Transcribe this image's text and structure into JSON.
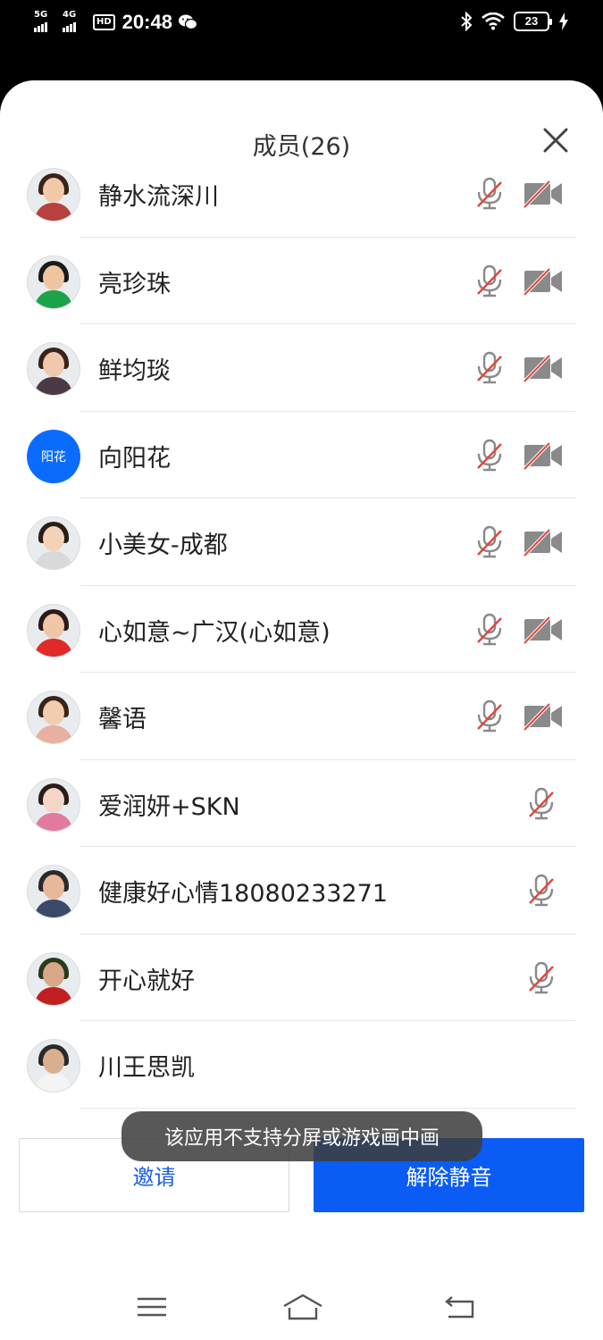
{
  "status_bar": {
    "signal1_label": "5G",
    "signal2_label": "4G",
    "hd_label": "HD",
    "time": "20:48",
    "battery": "23"
  },
  "sheet": {
    "title": "成员(26)"
  },
  "members": [
    {
      "name": "静水流深川",
      "avatar": "photo",
      "mic_muted": true,
      "camera_off": true
    },
    {
      "name": "亮珍珠",
      "avatar": "photo",
      "mic_muted": true,
      "camera_off": true
    },
    {
      "name": "鲜均琰",
      "avatar": "photo",
      "mic_muted": true,
      "camera_off": true
    },
    {
      "name": "向阳花",
      "avatar": "text",
      "avatar_text": "阳花",
      "mic_muted": true,
      "camera_off": true
    },
    {
      "name": "小美女-成都",
      "avatar": "photo",
      "mic_muted": true,
      "camera_off": true
    },
    {
      "name": "心如意~广汉(心如意)",
      "avatar": "photo",
      "mic_muted": true,
      "camera_off": true
    },
    {
      "name": "馨语",
      "avatar": "photo",
      "mic_muted": true,
      "camera_off": true
    },
    {
      "name": "爱润妍+SKN",
      "avatar": "photo",
      "mic_muted": true,
      "camera_off": false
    },
    {
      "name": "健康好心情18080233271",
      "avatar": "photo",
      "mic_muted": true,
      "camera_off": false
    },
    {
      "name": "开心就好",
      "avatar": "photo",
      "mic_muted": true,
      "camera_off": false
    },
    {
      "name": "川王思凯",
      "avatar": "photo",
      "mic_muted": false,
      "camera_off": false
    }
  ],
  "buttons": {
    "invite": "邀请",
    "unmute_all": "解除静音"
  },
  "toast": "该应用不支持分屏或游戏画中画",
  "colors": {
    "accent": "#0a5cf5",
    "muted_red": "#e0473e",
    "icon_gray": "#8a8a8a"
  }
}
